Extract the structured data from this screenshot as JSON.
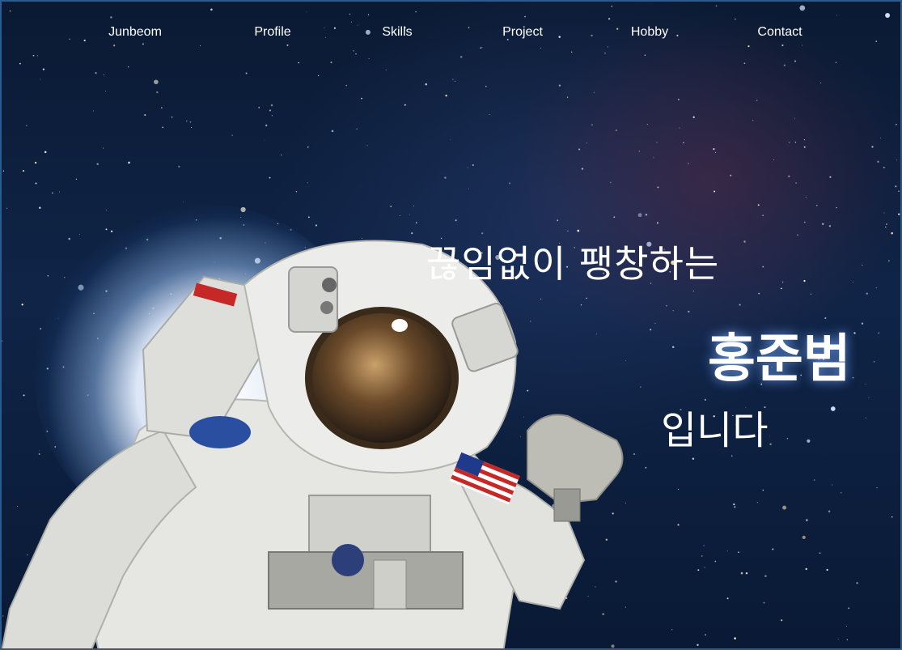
{
  "nav": {
    "items": [
      {
        "label": "Junbeom"
      },
      {
        "label": "Profile"
      },
      {
        "label": "Skills"
      },
      {
        "label": "Project"
      },
      {
        "label": "Hobby"
      },
      {
        "label": "Contact"
      }
    ]
  },
  "hero": {
    "line1": "끊임없이 팽창하는",
    "name": "홍준범",
    "line3": "입니다"
  },
  "colors": {
    "background": "#0f2447",
    "text": "#ffffff",
    "frame_border": "#2a5c8f"
  },
  "images": {
    "background": "starfield",
    "figure": "astronaut-waving"
  }
}
